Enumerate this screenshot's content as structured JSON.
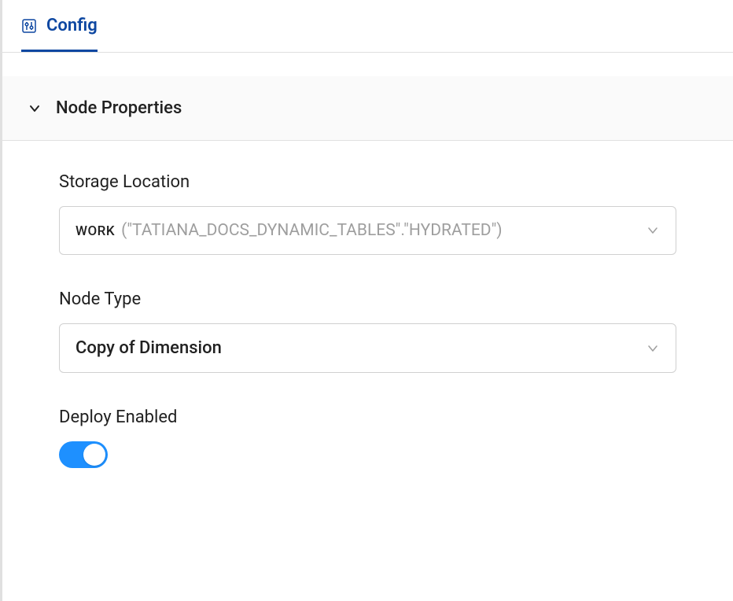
{
  "tab": {
    "label": "Config"
  },
  "section": {
    "title": "Node Properties"
  },
  "fields": {
    "storageLocation": {
      "label": "Storage Location",
      "prefix": "WORK",
      "path": "(\"TATIANA_DOCS_DYNAMIC_TABLES\".\"HYDRATED\")"
    },
    "nodeType": {
      "label": "Node Type",
      "value": "Copy of Dimension"
    },
    "deployEnabled": {
      "label": "Deploy Enabled",
      "on": true
    }
  },
  "colors": {
    "accent": "#0d47a1",
    "toggleOn": "#1e90ff"
  }
}
